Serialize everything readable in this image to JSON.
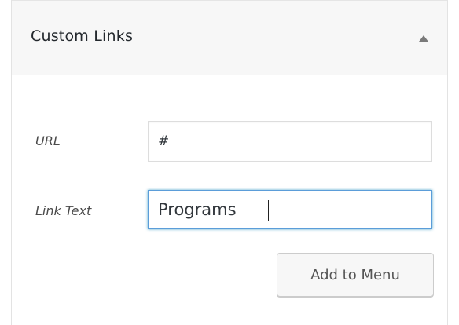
{
  "panel": {
    "title": "Custom Links",
    "toggle_icon": "triangle-up-icon"
  },
  "form": {
    "url": {
      "label": "URL",
      "value": "#"
    },
    "link_text": {
      "label": "Link Text",
      "value": "Programs"
    },
    "submit_label": "Add to Menu"
  },
  "colors": {
    "header_bg": "#f7f7f7",
    "focus_border": "#5b9dd9",
    "button_bg": "#f7f7f7"
  }
}
